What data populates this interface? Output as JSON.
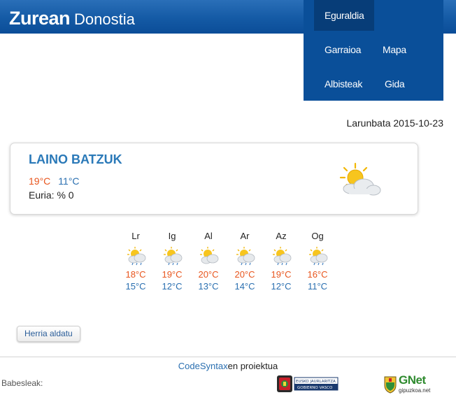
{
  "header": {
    "brand": "Zurean",
    "city": "Donostia"
  },
  "nav": {
    "items": [
      {
        "label": "Eguraldia",
        "active": true
      },
      {
        "label": "Garraioa",
        "active": false
      },
      {
        "label": "Mapa",
        "active": false
      },
      {
        "label": "Albisteak",
        "active": false
      },
      {
        "label": "Gida",
        "active": false
      }
    ]
  },
  "date": "Larunbata 2015-10-23",
  "current": {
    "condition": "LAINO BATZUK",
    "high": "19°C",
    "low": "11°C",
    "rain": "Euria: % 0",
    "icon": "partly-cloudy-icon"
  },
  "forecast": [
    {
      "day": "Lr",
      "high": "18°C",
      "low": "15°C",
      "icon": "sun-cloud-rain-icon"
    },
    {
      "day": "Ig",
      "high": "19°C",
      "low": "12°C",
      "icon": "sun-cloud-rain-icon"
    },
    {
      "day": "Al",
      "high": "20°C",
      "low": "13°C",
      "icon": "sun-cloud-icon"
    },
    {
      "day": "Ar",
      "high": "20°C",
      "low": "14°C",
      "icon": "sun-cloud-rain-icon"
    },
    {
      "day": "Az",
      "high": "19°C",
      "low": "12°C",
      "icon": "sun-cloud-rain-icon"
    },
    {
      "day": "Og",
      "high": "16°C",
      "low": "11°C",
      "icon": "sun-cloud-rain-icon"
    }
  ],
  "change_button": "Herria aldatu",
  "footer": {
    "project_link": "CodeSyntax",
    "project_suffix": "en proiektua",
    "sponsors_label": "Babesleak:",
    "logo_ej_line1": "EUSKO JAURLARITZA",
    "logo_ej_line2": "GOBIERNO VASCO",
    "logo_gnet": "GNet",
    "logo_gnet_sub": "gipuzkoa.net"
  },
  "colors": {
    "brand_blue": "#145aa5",
    "nav_blue": "#0a4f99",
    "hot": "#e8551d",
    "cold": "#2a6fb0"
  }
}
